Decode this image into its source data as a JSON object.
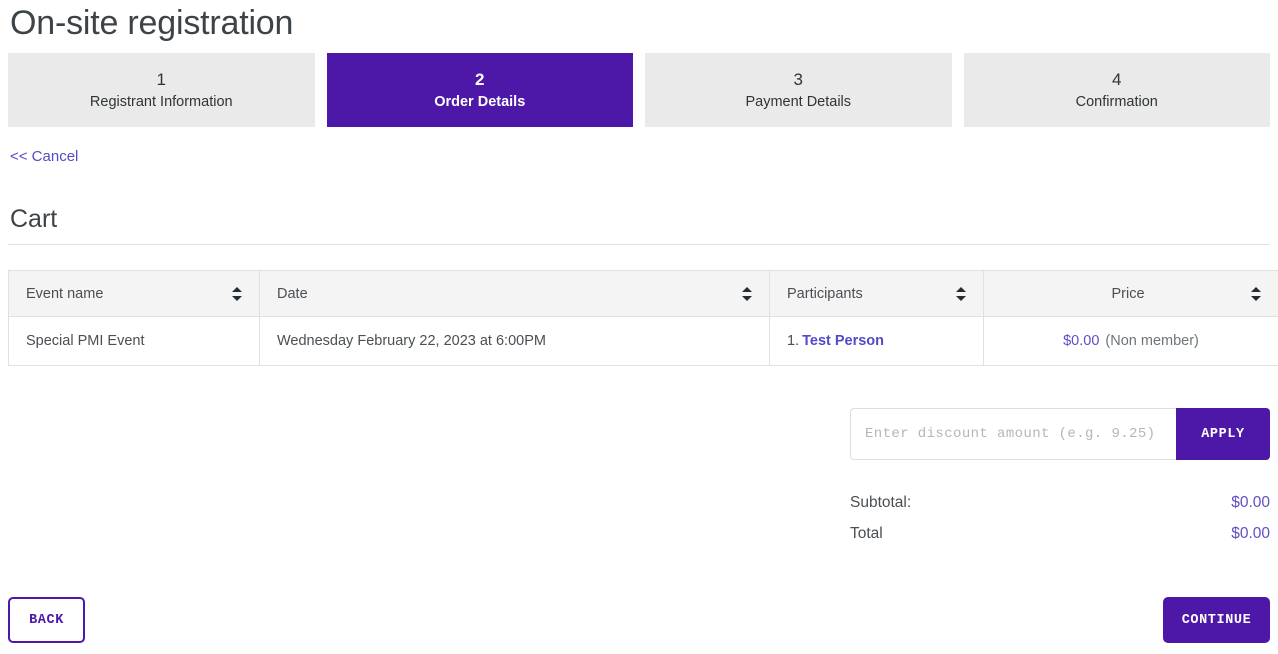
{
  "page": {
    "title": "On-site registration"
  },
  "steps": [
    {
      "number": "1",
      "label": "Registrant Information",
      "active": false
    },
    {
      "number": "2",
      "label": "Order Details",
      "active": true
    },
    {
      "number": "3",
      "label": "Payment Details",
      "active": false
    },
    {
      "number": "4",
      "label": "Confirmation",
      "active": false
    }
  ],
  "cancel": {
    "label": "<< Cancel"
  },
  "cart": {
    "heading": "Cart",
    "columns": [
      {
        "label": "Event name",
        "sortable": true
      },
      {
        "label": "Date",
        "sortable": true
      },
      {
        "label": "Participants",
        "sortable": true
      },
      {
        "label": "Price",
        "sortable": true
      }
    ],
    "rows": [
      {
        "event_name": "Special PMI Event",
        "date": "Wednesday February 22, 2023 at 6:00PM",
        "participant_index": "1.",
        "participant_name": "Test Person",
        "price": "$0.00",
        "price_note": "(Non member)"
      }
    ]
  },
  "discount": {
    "placeholder": "Enter discount amount (e.g. 9.25)",
    "value": "",
    "apply_label": "APPLY"
  },
  "totals": {
    "subtotal_label": "Subtotal:",
    "subtotal_value": "$0.00",
    "total_label": "Total",
    "total_value": "$0.00"
  },
  "footer": {
    "back_label": "BACK",
    "continue_label": "CONTINUE"
  },
  "colors": {
    "brand_purple": "#4d17a8",
    "link_purple": "#5549c8",
    "value_purple": "#5f4fc4",
    "step_inactive_bg": "#eaeaea",
    "table_header_bg": "#f4f4f4"
  }
}
